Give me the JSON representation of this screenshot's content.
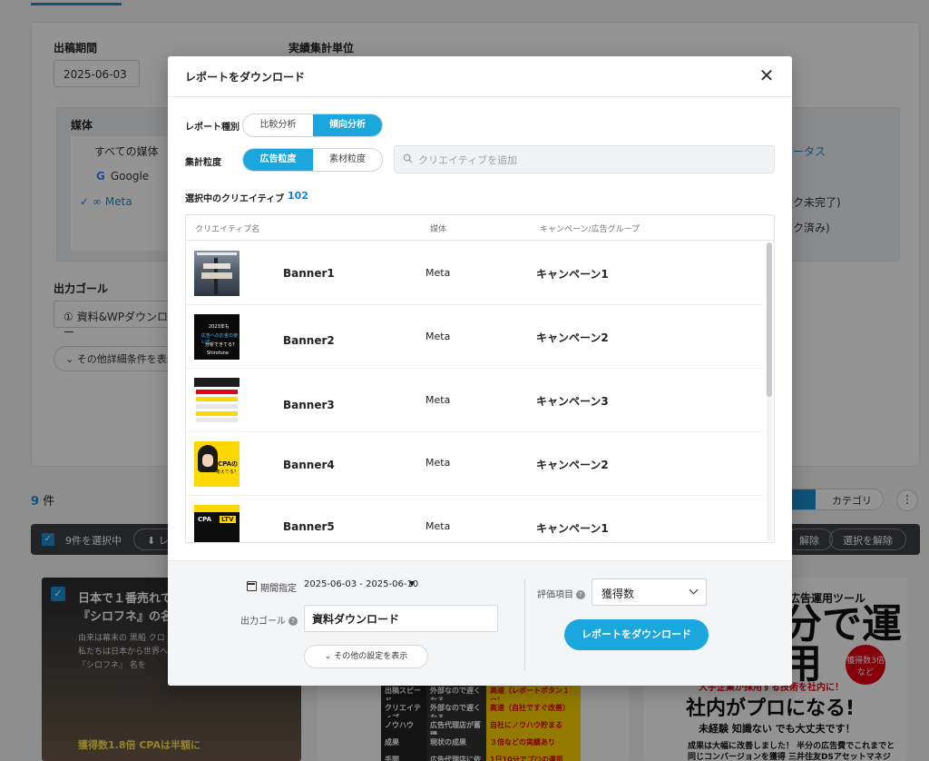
{
  "background": {
    "period_label": "出稿期間",
    "period_value": "2025-06-03",
    "unit_label": "実績集計単位",
    "media_label": "媒体",
    "media_items": [
      "すべての媒体",
      "Google",
      "Meta"
    ],
    "status_label": "ータス",
    "status_item_1": "ク未完了)",
    "status_item_2": "ク済み)",
    "goal_label": "出力ゴール",
    "goal_value": "① 資料&WPダウンロー",
    "more_filter": "その他詳細条件を表示",
    "count_number": "9",
    "count_suffix": "件",
    "selected_text": "9件を選択中",
    "download_btn": "レ",
    "deselect_partial": "解除",
    "deselect_btn": "選択を解除",
    "category_toggle": "カテゴリ",
    "more_icon": "⋮",
    "thumb1_lines": [
      "日本で１番売れて",
      "『シロフネ』の名前の"
    ],
    "thumb1_sub": [
      "由来は幕末の 黒船 クロ",
      "私たちは日本から世界へ",
      "『シロフネ』 名を"
    ],
    "thumb1_bottom": "獲得数1.8倍 CPAは半額に",
    "thumb2_rows": [
      [
        "出稿スピード",
        "外部なので遅くなる",
        "高速（レポートボタン１つ）"
      ],
      [
        "クリエイティブ",
        "外部なので遅くなる",
        "高速（自社ですぐ改善）"
      ],
      [
        "ノウハウ",
        "広告代理店が蓄積",
        "自社にノウハウ貯まる"
      ],
      [
        "成果",
        "現状の成果",
        "３倍などの実績あり"
      ],
      [
        "手間",
        "広告代理店に依頼",
        "1日10分でプロの運用"
      ]
    ],
    "thumb3_head": "広告運用ツール",
    "thumb3_big": "分で運用",
    "thumb3_badge": "獲得数3倍など",
    "thumb3_line1": "大手企業が採用する技術を社内に！",
    "thumb3_line2": "社内がプロになる!",
    "thumb3_line3": "未経験 知識ない でも大丈夫です！",
    "thumb3_line4": "成果は大幅に改善しました！ 半分の広告費でこれまでと同じコンバージョンを獲得 三井住友DSアセットマネジメント株式会社"
  },
  "modal": {
    "title": "レポートをダウンロード",
    "close_icon": "✕",
    "report_type_label": "レポート種別",
    "report_type_options": [
      "比較分析",
      "傾向分析"
    ],
    "report_type_selected": "傾向分析",
    "granularity_label": "集計粒度",
    "granularity_options": [
      "広告粒度",
      "素材粒度"
    ],
    "granularity_selected": "広告粒度",
    "search_placeholder": "クリエイティブを追加",
    "selected_label": "選択中のクリエイティブ",
    "selected_count": "102",
    "table": {
      "headers": [
        "クリエイティブ名",
        "媒体",
        "キャンペーン/広告グループ"
      ],
      "rows": [
        {
          "name": "Banner1",
          "media": "Meta",
          "campaign": "キャンペーン1"
        },
        {
          "name": "Banner2",
          "media": "Meta",
          "campaign": "キャンペーン2"
        },
        {
          "name": "Banner3",
          "media": "Meta",
          "campaign": "キャンペーン3"
        },
        {
          "name": "Banner4",
          "media": "Meta",
          "campaign": "キャンペーン2"
        },
        {
          "name": "Banner5",
          "media": "Meta",
          "campaign": "キャンペーン1"
        }
      ],
      "thumb2_lines": [
        "2023年も",
        "広告へのお金の使い方",
        "分析できてる？",
        "Shirofune"
      ],
      "thumb4_lines": [
        "CPAの",
        "考えてる？"
      ],
      "thumb5_lines": [
        "CPA",
        "LTV"
      ]
    },
    "footer": {
      "period_label": "期間指定",
      "period_value": "2025-06-03 - 2025-06-10",
      "period_caret": "▼",
      "goal_label": "出力ゴール",
      "goal_value": "資料ダウンロード",
      "more_settings": "その他の設定を表示",
      "eval_label": "評価項目",
      "eval_value": "獲得数",
      "download_label": "レポートをダウンロード"
    }
  },
  "colors": {
    "accent": "#1aa7de",
    "link_blue": "#1a7fd1",
    "overlay": "rgba(0,0,0,0.42)"
  }
}
